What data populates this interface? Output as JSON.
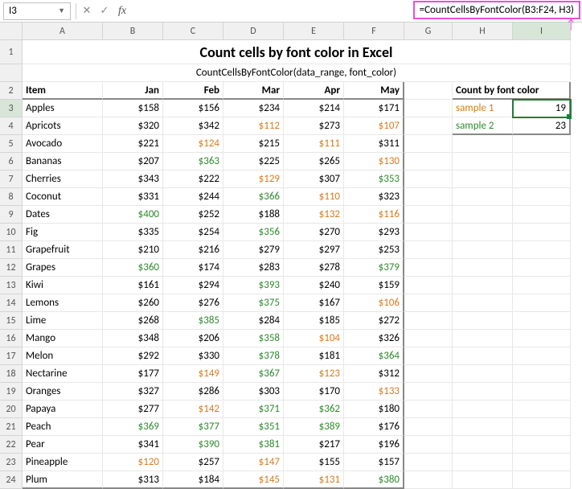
{
  "nameBox": "I3",
  "formula": "=CountCellsByFontColor(B3:F24, H3)",
  "columns": [
    "A",
    "B",
    "C",
    "D",
    "E",
    "F",
    "G",
    "H",
    "I"
  ],
  "title": "Count cells by font color in Excel",
  "subtitle": "CountCellsByFontColor(data_range, font_color)",
  "headers": {
    "item": "Item",
    "jan": "Jan",
    "feb": "Feb",
    "mar": "Mar",
    "apr": "Apr",
    "may": "May"
  },
  "countHeader": "Count by font color",
  "samples": [
    {
      "label": "sample 1",
      "color": "orange",
      "value": "19"
    },
    {
      "label": "sample 2",
      "color": "green",
      "value": "23"
    }
  ],
  "rows": [
    {
      "n": 3,
      "item": "Apples",
      "v": [
        {
          "t": "$158"
        },
        {
          "t": "$156"
        },
        {
          "t": "$234"
        },
        {
          "t": "$214"
        },
        {
          "t": "$171"
        }
      ]
    },
    {
      "n": 4,
      "item": "Apricots",
      "v": [
        {
          "t": "$320"
        },
        {
          "t": "$342"
        },
        {
          "t": "$112",
          "c": "orange"
        },
        {
          "t": "$273"
        },
        {
          "t": "$107",
          "c": "orange"
        }
      ]
    },
    {
      "n": 5,
      "item": "Avocado",
      "v": [
        {
          "t": "$221"
        },
        {
          "t": "$124",
          "c": "orange"
        },
        {
          "t": "$215"
        },
        {
          "t": "$111",
          "c": "orange"
        },
        {
          "t": "$311"
        }
      ]
    },
    {
      "n": 6,
      "item": "Bananas",
      "v": [
        {
          "t": "$207"
        },
        {
          "t": "$363",
          "c": "green"
        },
        {
          "t": "$225"
        },
        {
          "t": "$265"
        },
        {
          "t": "$130",
          "c": "orange"
        }
      ]
    },
    {
      "n": 7,
      "item": "Cherries",
      "v": [
        {
          "t": "$343"
        },
        {
          "t": "$222"
        },
        {
          "t": "$129",
          "c": "orange"
        },
        {
          "t": "$307"
        },
        {
          "t": "$353",
          "c": "green"
        }
      ]
    },
    {
      "n": 8,
      "item": "Coconut",
      "v": [
        {
          "t": "$331"
        },
        {
          "t": "$244"
        },
        {
          "t": "$366",
          "c": "green"
        },
        {
          "t": "$110",
          "c": "orange"
        },
        {
          "t": "$323"
        }
      ]
    },
    {
      "n": 9,
      "item": "Dates",
      "v": [
        {
          "t": "$400",
          "c": "green"
        },
        {
          "t": "$252"
        },
        {
          "t": "$188"
        },
        {
          "t": "$132",
          "c": "orange"
        },
        {
          "t": "$116",
          "c": "orange"
        }
      ]
    },
    {
      "n": 10,
      "item": "Fig",
      "v": [
        {
          "t": "$335"
        },
        {
          "t": "$254"
        },
        {
          "t": "$356",
          "c": "green"
        },
        {
          "t": "$270"
        },
        {
          "t": "$293"
        }
      ]
    },
    {
      "n": 11,
      "item": "Grapefruit",
      "v": [
        {
          "t": "$210"
        },
        {
          "t": "$216"
        },
        {
          "t": "$279"
        },
        {
          "t": "$297"
        },
        {
          "t": "$253"
        }
      ]
    },
    {
      "n": 12,
      "item": "Grapes",
      "v": [
        {
          "t": "$360",
          "c": "green"
        },
        {
          "t": "$174"
        },
        {
          "t": "$283"
        },
        {
          "t": "$278"
        },
        {
          "t": "$379",
          "c": "green"
        }
      ]
    },
    {
      "n": 13,
      "item": "Kiwi",
      "v": [
        {
          "t": "$161"
        },
        {
          "t": "$294"
        },
        {
          "t": "$393",
          "c": "green"
        },
        {
          "t": "$240"
        },
        {
          "t": "$159"
        }
      ]
    },
    {
      "n": 14,
      "item": "Lemons",
      "v": [
        {
          "t": "$260"
        },
        {
          "t": "$276"
        },
        {
          "t": "$375",
          "c": "green"
        },
        {
          "t": "$167"
        },
        {
          "t": "$106",
          "c": "orange"
        }
      ]
    },
    {
      "n": 15,
      "item": "Lime",
      "v": [
        {
          "t": "$268"
        },
        {
          "t": "$385",
          "c": "green"
        },
        {
          "t": "$284"
        },
        {
          "t": "$185"
        },
        {
          "t": "$272"
        }
      ]
    },
    {
      "n": 16,
      "item": "Mango",
      "v": [
        {
          "t": "$348"
        },
        {
          "t": "$206"
        },
        {
          "t": "$358",
          "c": "green"
        },
        {
          "t": "$104",
          "c": "orange"
        },
        {
          "t": "$326"
        }
      ]
    },
    {
      "n": 17,
      "item": "Melon",
      "v": [
        {
          "t": "$292"
        },
        {
          "t": "$330"
        },
        {
          "t": "$378",
          "c": "green"
        },
        {
          "t": "$181"
        },
        {
          "t": "$364",
          "c": "green"
        }
      ]
    },
    {
      "n": 18,
      "item": "Nectarine",
      "v": [
        {
          "t": "$177"
        },
        {
          "t": "$149",
          "c": "orange"
        },
        {
          "t": "$367",
          "c": "green"
        },
        {
          "t": "$123",
          "c": "orange"
        },
        {
          "t": "$312"
        }
      ]
    },
    {
      "n": 19,
      "item": "Oranges",
      "v": [
        {
          "t": "$327"
        },
        {
          "t": "$286"
        },
        {
          "t": "$303"
        },
        {
          "t": "$170"
        },
        {
          "t": "$133",
          "c": "orange"
        }
      ]
    },
    {
      "n": 20,
      "item": "Papaya",
      "v": [
        {
          "t": "$277"
        },
        {
          "t": "$142",
          "c": "orange"
        },
        {
          "t": "$371",
          "c": "green"
        },
        {
          "t": "$362",
          "c": "green"
        },
        {
          "t": "$180"
        }
      ]
    },
    {
      "n": 21,
      "item": "Peach",
      "v": [
        {
          "t": "$369",
          "c": "green"
        },
        {
          "t": "$377",
          "c": "green"
        },
        {
          "t": "$351",
          "c": "green"
        },
        {
          "t": "$389",
          "c": "green"
        },
        {
          "t": "$176"
        }
      ]
    },
    {
      "n": 22,
      "item": "Pear",
      "v": [
        {
          "t": "$341"
        },
        {
          "t": "$390",
          "c": "green"
        },
        {
          "t": "$381",
          "c": "green"
        },
        {
          "t": "$217"
        },
        {
          "t": "$196"
        }
      ]
    },
    {
      "n": 23,
      "item": "Pineapple",
      "v": [
        {
          "t": "$120",
          "c": "orange"
        },
        {
          "t": "$257"
        },
        {
          "t": "$147",
          "c": "orange"
        },
        {
          "t": "$155"
        },
        {
          "t": "$157"
        }
      ]
    },
    {
      "n": 24,
      "item": "Plum",
      "v": [
        {
          "t": "$313"
        },
        {
          "t": "$184"
        },
        {
          "t": "$145",
          "c": "orange"
        },
        {
          "t": "$131",
          "c": "orange"
        },
        {
          "t": "$380",
          "c": "green"
        }
      ]
    }
  ],
  "chart_data": {
    "type": "table",
    "title": "Count cells by font color in Excel",
    "columns": [
      "Item",
      "Jan",
      "Feb",
      "Mar",
      "Apr",
      "May"
    ],
    "rows": [
      [
        "Apples",
        158,
        156,
        234,
        214,
        171
      ],
      [
        "Apricots",
        320,
        342,
        112,
        273,
        107
      ],
      [
        "Avocado",
        221,
        124,
        215,
        111,
        311
      ],
      [
        "Bananas",
        207,
        363,
        225,
        265,
        130
      ],
      [
        "Cherries",
        343,
        222,
        129,
        307,
        353
      ],
      [
        "Coconut",
        331,
        244,
        366,
        110,
        323
      ],
      [
        "Dates",
        400,
        252,
        188,
        132,
        116
      ],
      [
        "Fig",
        335,
        254,
        356,
        270,
        293
      ],
      [
        "Grapefruit",
        210,
        216,
        279,
        297,
        253
      ],
      [
        "Grapes",
        360,
        174,
        283,
        278,
        379
      ],
      [
        "Kiwi",
        161,
        294,
        393,
        240,
        159
      ],
      [
        "Lemons",
        260,
        276,
        375,
        167,
        106
      ],
      [
        "Lime",
        268,
        385,
        284,
        185,
        272
      ],
      [
        "Mango",
        348,
        206,
        358,
        104,
        326
      ],
      [
        "Melon",
        292,
        330,
        378,
        181,
        364
      ],
      [
        "Nectarine",
        177,
        149,
        367,
        123,
        312
      ],
      [
        "Oranges",
        327,
        286,
        303,
        170,
        133
      ],
      [
        "Papaya",
        277,
        142,
        371,
        362,
        180
      ],
      [
        "Peach",
        369,
        377,
        351,
        389,
        176
      ],
      [
        "Pear",
        341,
        390,
        381,
        217,
        196
      ],
      [
        "Pineapple",
        120,
        257,
        147,
        155,
        157
      ],
      [
        "Plum",
        313,
        184,
        145,
        131,
        380
      ]
    ],
    "counts": {
      "sample 1 (orange)": 19,
      "sample 2 (green)": 23
    }
  }
}
